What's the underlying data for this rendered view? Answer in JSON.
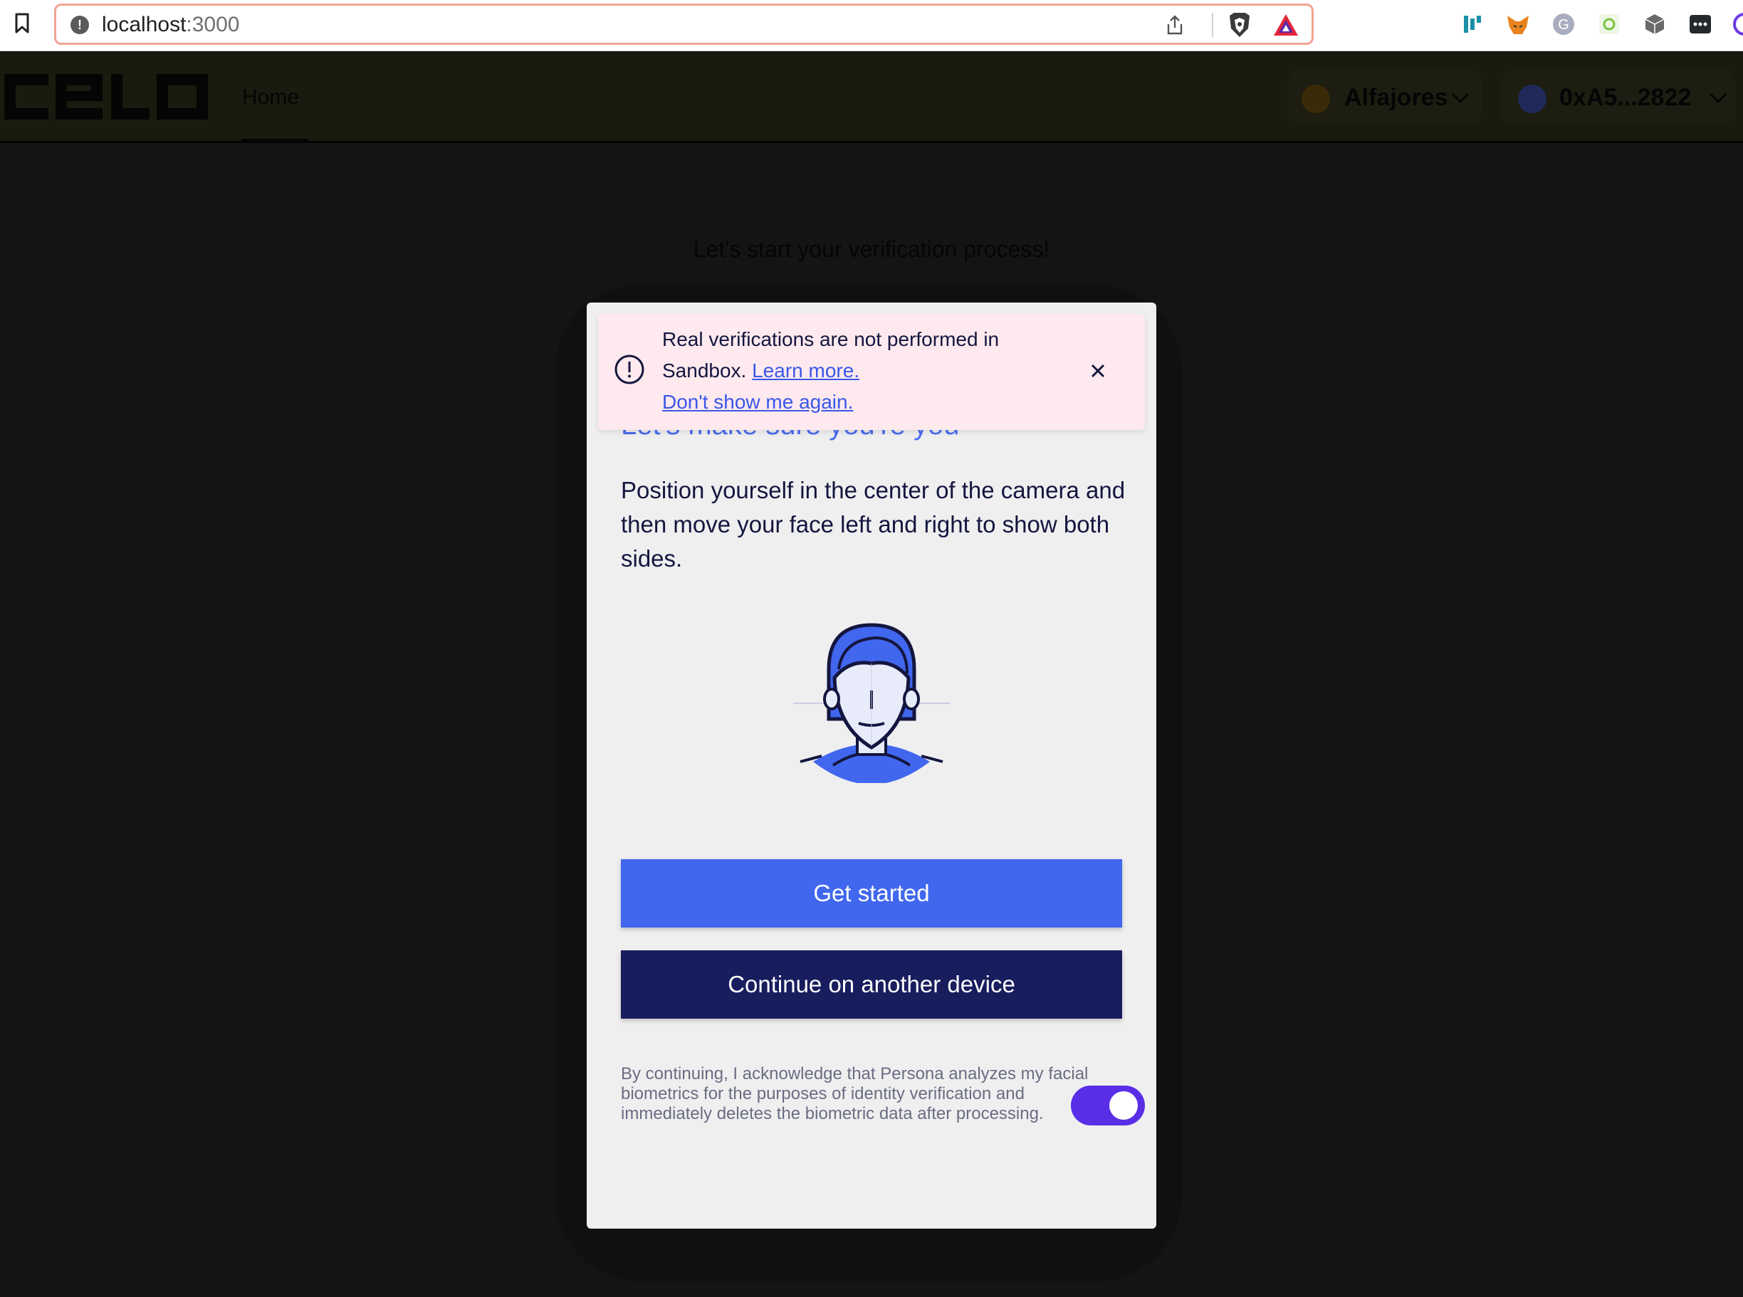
{
  "browser": {
    "url_host": "localhost",
    "url_port": ":3000",
    "extension_icons": [
      "dapp-icon",
      "metamask-icon",
      "grammarly-icon",
      "wallet-icon",
      "cube-icon",
      "dots-icon"
    ]
  },
  "nav": {
    "logo": "celo",
    "home_label": "Home",
    "network_label": "Alfajores",
    "account_label": "0xA5...2822"
  },
  "page": {
    "heading": "Let's start your verification process!"
  },
  "modal": {
    "title_peek": "Let's make sure you're you",
    "banner": {
      "text_before": "Real verifications are not performed in Sandbox.",
      "learn_more": "Learn more.",
      "dont_show": "Don't show me again."
    },
    "description": "Position yourself in the center of the camera and then move your face left and right to show both sides.",
    "get_started": "Get started",
    "continue_other": "Continue on another device",
    "consent": "By continuing, I acknowledge that Persona analyzes my facial biometrics for the purposes of identity verification and immediately deletes the biometric data after processing.",
    "consent_toggle_on": true
  },
  "colors": {
    "primary": "#4167ef",
    "secondary": "#181d5e",
    "toggle": "#5a2ee6",
    "banner_bg": "#fde9ee"
  }
}
